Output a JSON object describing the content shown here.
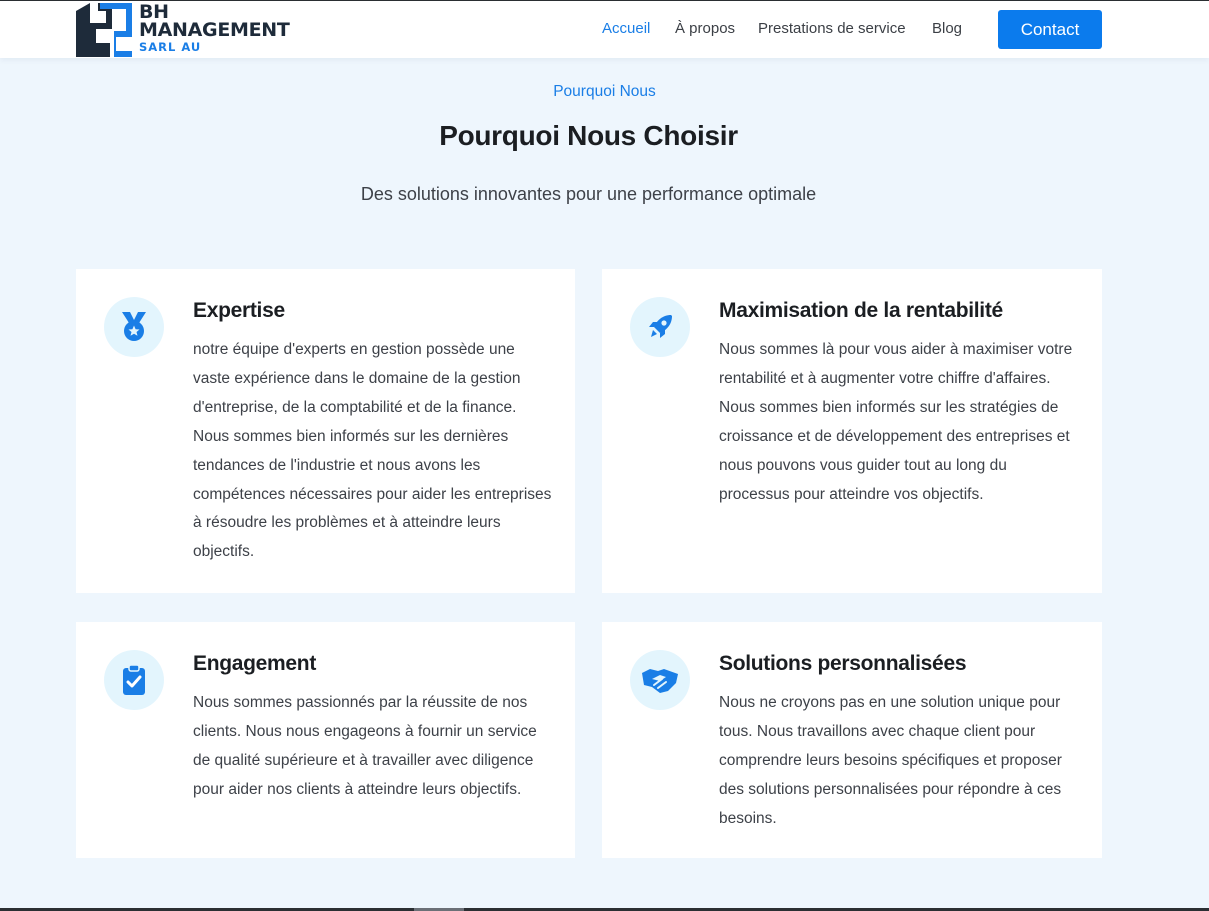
{
  "brand": {
    "line1": "BH",
    "line2": "MANAGEMENT",
    "line3": "SARL AU",
    "dark_color": "#1e2b3a",
    "accent_color": "#1a7ee6"
  },
  "nav": {
    "items": [
      {
        "label": "Accueil",
        "active": true
      },
      {
        "label": "À propos",
        "active": false
      },
      {
        "label": "Prestations de service",
        "active": false
      },
      {
        "label": "Blog",
        "active": false
      }
    ],
    "contact_label": "Contact"
  },
  "section": {
    "kicker": "Pourquoi Nous",
    "title": "Pourquoi Nous Choisir",
    "subtitle": "Des solutions innovantes pour une performance optimale"
  },
  "cards": [
    {
      "icon": "medal-icon",
      "title": "Expertise",
      "text": "notre équipe d'experts en gestion possède une vaste expérience dans le domaine de la gestion d'entreprise, de la comptabilité et de la finance. Nous sommes bien informés sur les dernières tendances de l'industrie et nous avons les compétences nécessaires pour aider les entreprises à résoudre les problèmes et à atteindre leurs objectifs."
    },
    {
      "icon": "rocket-icon",
      "title": "Maximisation de la rentabilité",
      "text": "Nous sommes là pour vous aider à maximiser votre rentabilité et à augmenter votre chiffre d'affaires. Nous sommes bien informés sur les stratégies de croissance et de développement des entreprises et nous pouvons vous guider tout au long du processus pour atteindre vos objectifs."
    },
    {
      "icon": "clipboard-check-icon",
      "title": "Engagement",
      "text": "Nous sommes passionnés par la réussite de nos clients. Nous nous engageons à fournir un service de qualité supérieure et à travailler avec diligence pour aider nos clients à atteindre leurs objectifs."
    },
    {
      "icon": "handshake-icon",
      "title": "Solutions personnalisées",
      "text": "Nous ne croyons pas en une solution unique pour tous. Nous travaillons avec chaque client pour comprendre leurs besoins spécifiques et proposer des solutions personnalisées pour répondre à ces besoins."
    }
  ],
  "colors": {
    "background": "#eef6fd",
    "primary_button": "#0b7bed",
    "icon_circle": "#e3f5fd"
  }
}
